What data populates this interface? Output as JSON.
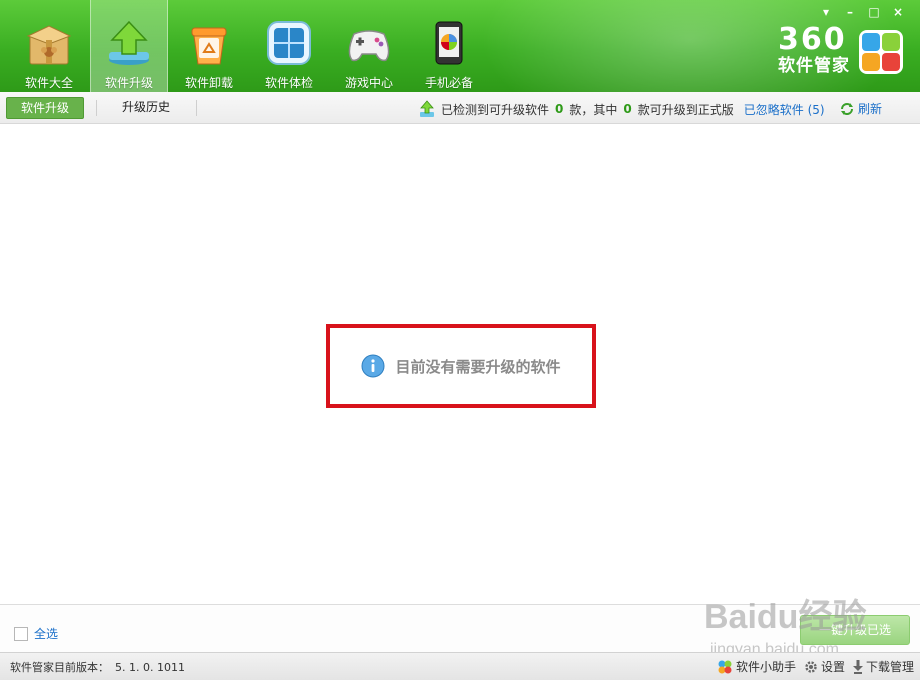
{
  "nav": [
    {
      "label": "软件大全",
      "icon": "software-box-icon"
    },
    {
      "label": "软件升级",
      "icon": "upgrade-arrow-icon",
      "active": true
    },
    {
      "label": "软件卸载",
      "icon": "recycle-bin-icon"
    },
    {
      "label": "软件体检",
      "icon": "window-check-icon"
    },
    {
      "label": "游戏中心",
      "icon": "gamepad-icon"
    },
    {
      "label": "手机必备",
      "icon": "mobile-phone-icon"
    }
  ],
  "window_controls": {
    "menu": "▾",
    "minimize": "–",
    "maximize": "□",
    "close": "×"
  },
  "brand": {
    "number": "360",
    "name": "软件管家"
  },
  "subtabs": {
    "upgrade": "软件升级",
    "history": "升级历史"
  },
  "status": {
    "prefix": "已检测到可升级软件",
    "count_upgradable": "0",
    "mid": "款，其中",
    "count_formal": "0",
    "suffix": "款可升级到正式版",
    "ignored_link": "已忽略软件",
    "ignored_count": "(5)",
    "refresh": "刷新"
  },
  "empty_message": "目前没有需要升级的软件",
  "footer": {
    "select_all": "全选",
    "upgrade_selected": "一键升级已选"
  },
  "statusbar": {
    "version_label": "软件管家目前版本：",
    "version_value": "5. 1. 0. 1011",
    "assistant": "软件小助手",
    "settings": "设置",
    "download_manager": "下载管理"
  },
  "watermark": {
    "text": "Baidu经验",
    "url": "jingyan.baidu.com"
  },
  "colors": {
    "brand_green": "#3aae22",
    "active_tab": "#68b24b",
    "highlight_border": "#d8121b",
    "link_blue": "#1a6fc9"
  }
}
